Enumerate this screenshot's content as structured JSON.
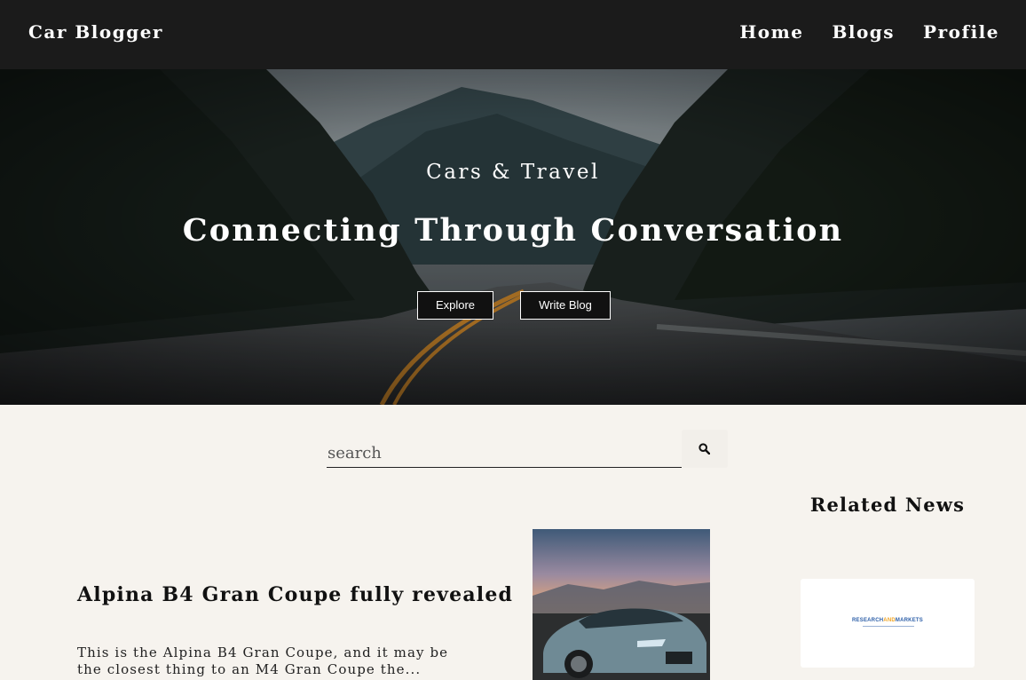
{
  "navbar": {
    "brand": "Car Blogger",
    "links": [
      "Home",
      "Blogs",
      "Profile"
    ]
  },
  "hero": {
    "subtitle": "Cars & Travel",
    "title": "Connecting Through Conversation",
    "buttons": {
      "explore": "Explore",
      "write": "Write Blog"
    }
  },
  "search": {
    "placeholder": "search",
    "button_icon": "search-icon"
  },
  "post": {
    "title": "Alpina B4 Gran Coupe fully revealed",
    "excerpt": "This is the Alpina B4 Gran Coupe, and it may be the closest thing to an M4 Gran Coupe the..."
  },
  "related": {
    "title": "Related News",
    "card_logo": {
      "main": "RESEARCH",
      "accent": "AND",
      "tail": "MARKETS"
    }
  },
  "colors": {
    "navbar_bg": "#1b1b1b",
    "page_bg": "#f6f3ee",
    "text": "#111111",
    "logo_blue": "#2d5fa8",
    "logo_orange": "#f0a524"
  }
}
